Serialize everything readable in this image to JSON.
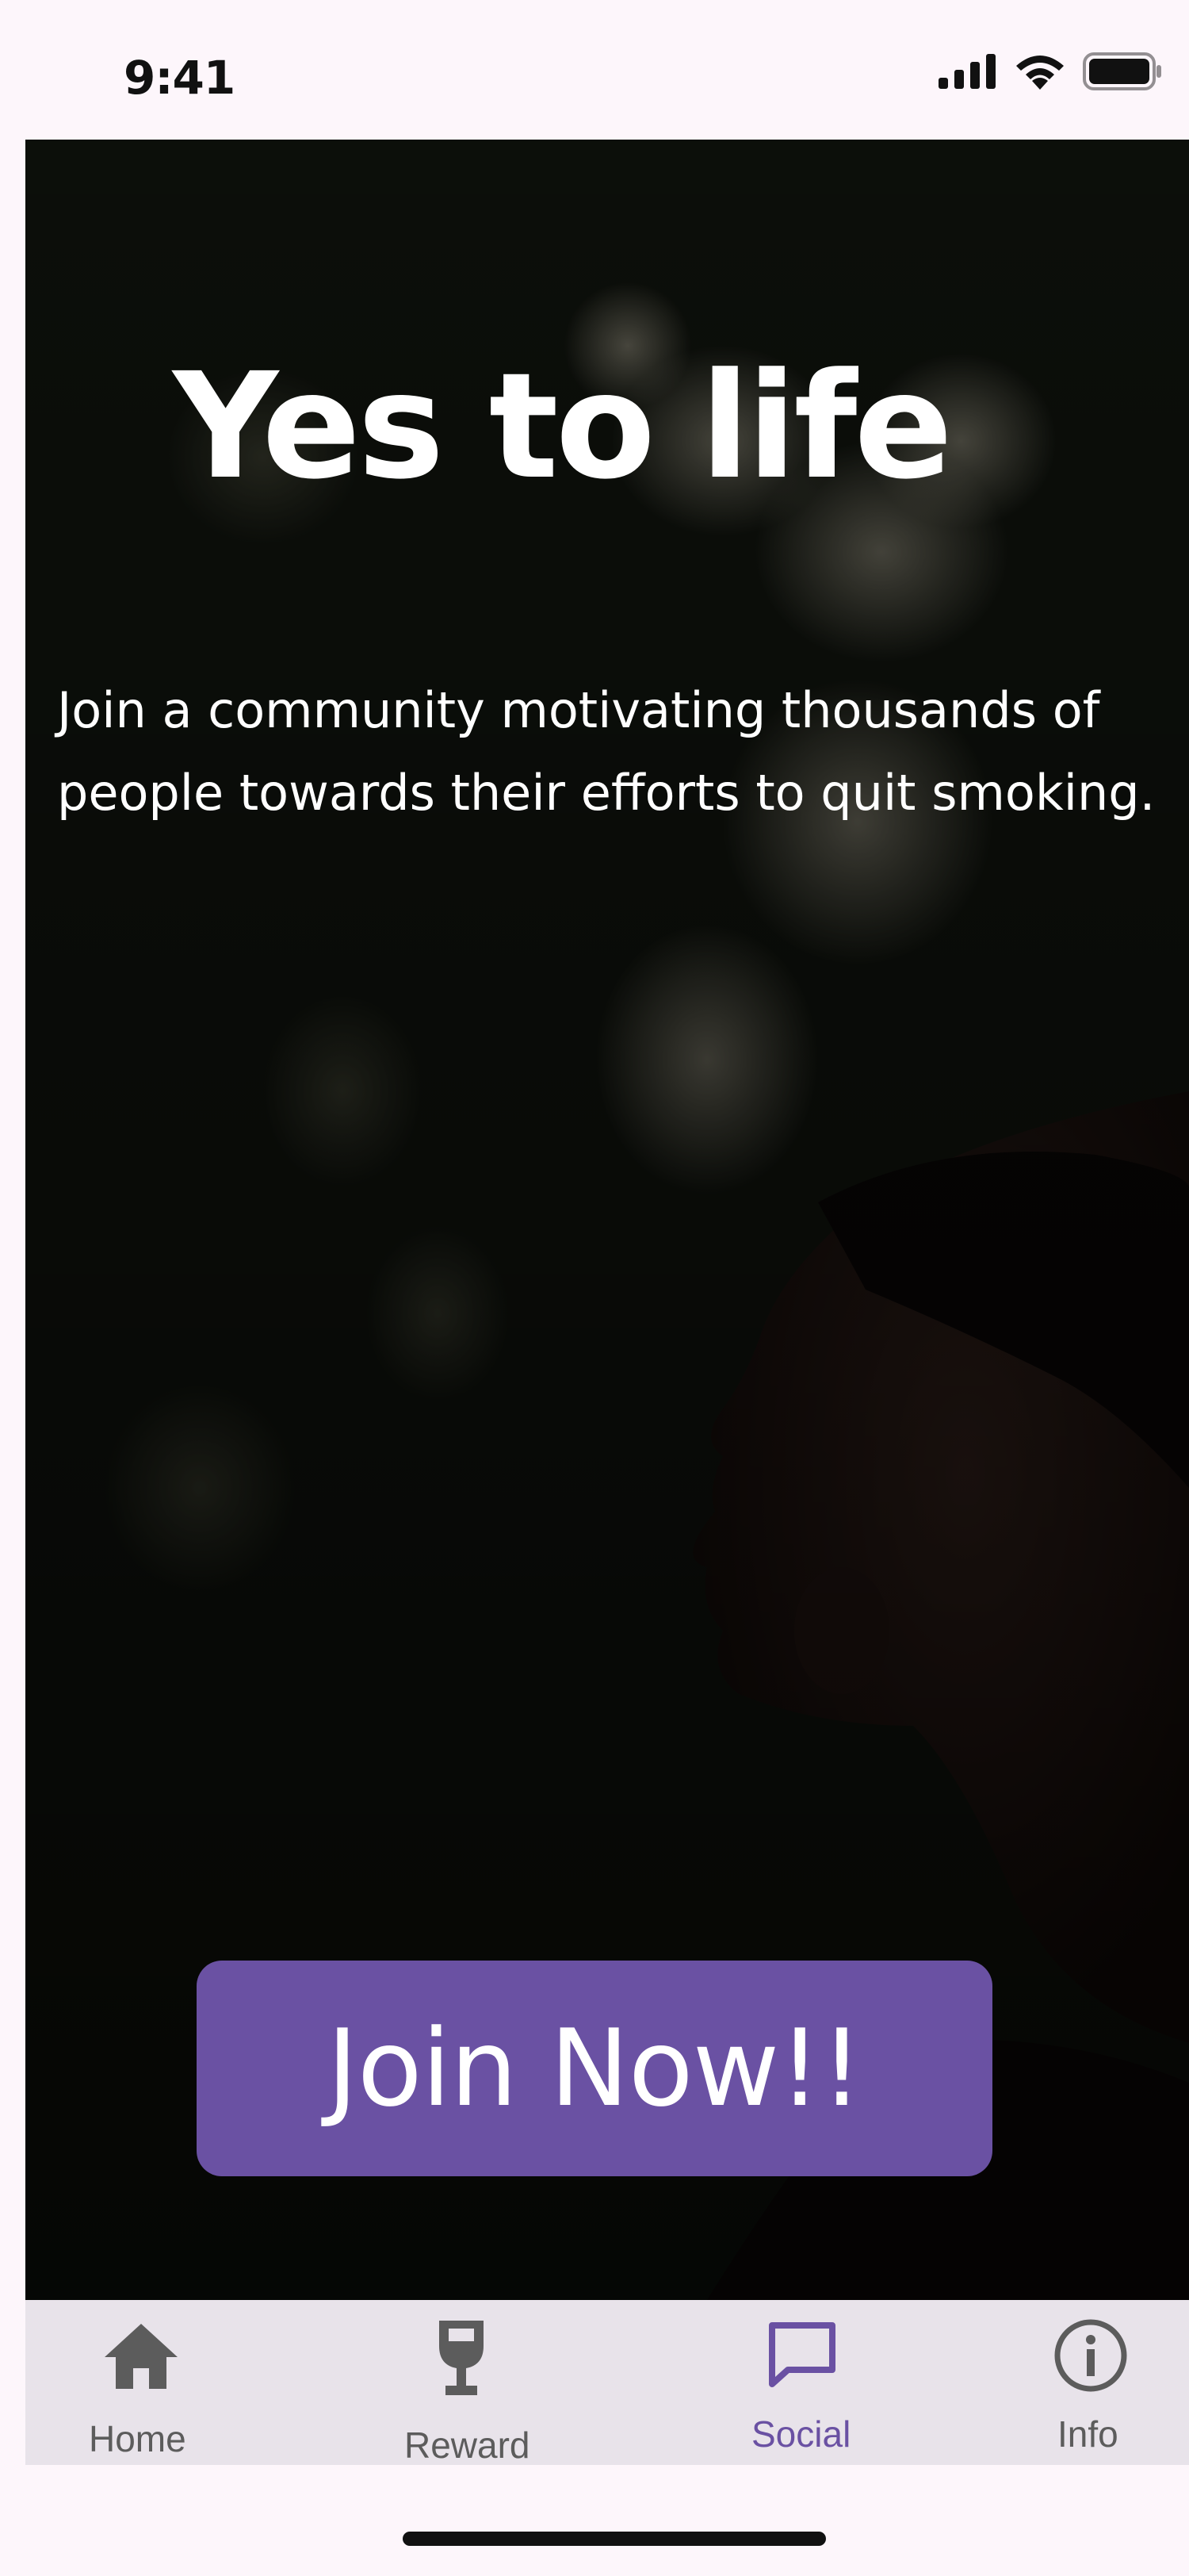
{
  "status_bar": {
    "time": "9:41",
    "icons": [
      "cellular-signal-icon",
      "wifi-icon",
      "battery-icon"
    ]
  },
  "hero": {
    "title": "Yes to life",
    "subtitle": "Join a community motivating thousands of people towards their efforts to quit smoking.",
    "cta_label": "Join Now!!"
  },
  "tab_bar": {
    "items": [
      {
        "label": "Home",
        "icon": "home-icon",
        "active": false
      },
      {
        "label": "Reward",
        "icon": "wine-glass-icon",
        "active": false
      },
      {
        "label": "Social",
        "icon": "chat-bubble-icon",
        "active": true
      },
      {
        "label": "Info",
        "icon": "info-icon",
        "active": false
      }
    ]
  },
  "colors": {
    "accent": "#6a51a3",
    "tab_bar_bg": "#e8e3ea",
    "inactive_tab": "#5c5c5c",
    "page_bg": "#fdf6fb"
  }
}
